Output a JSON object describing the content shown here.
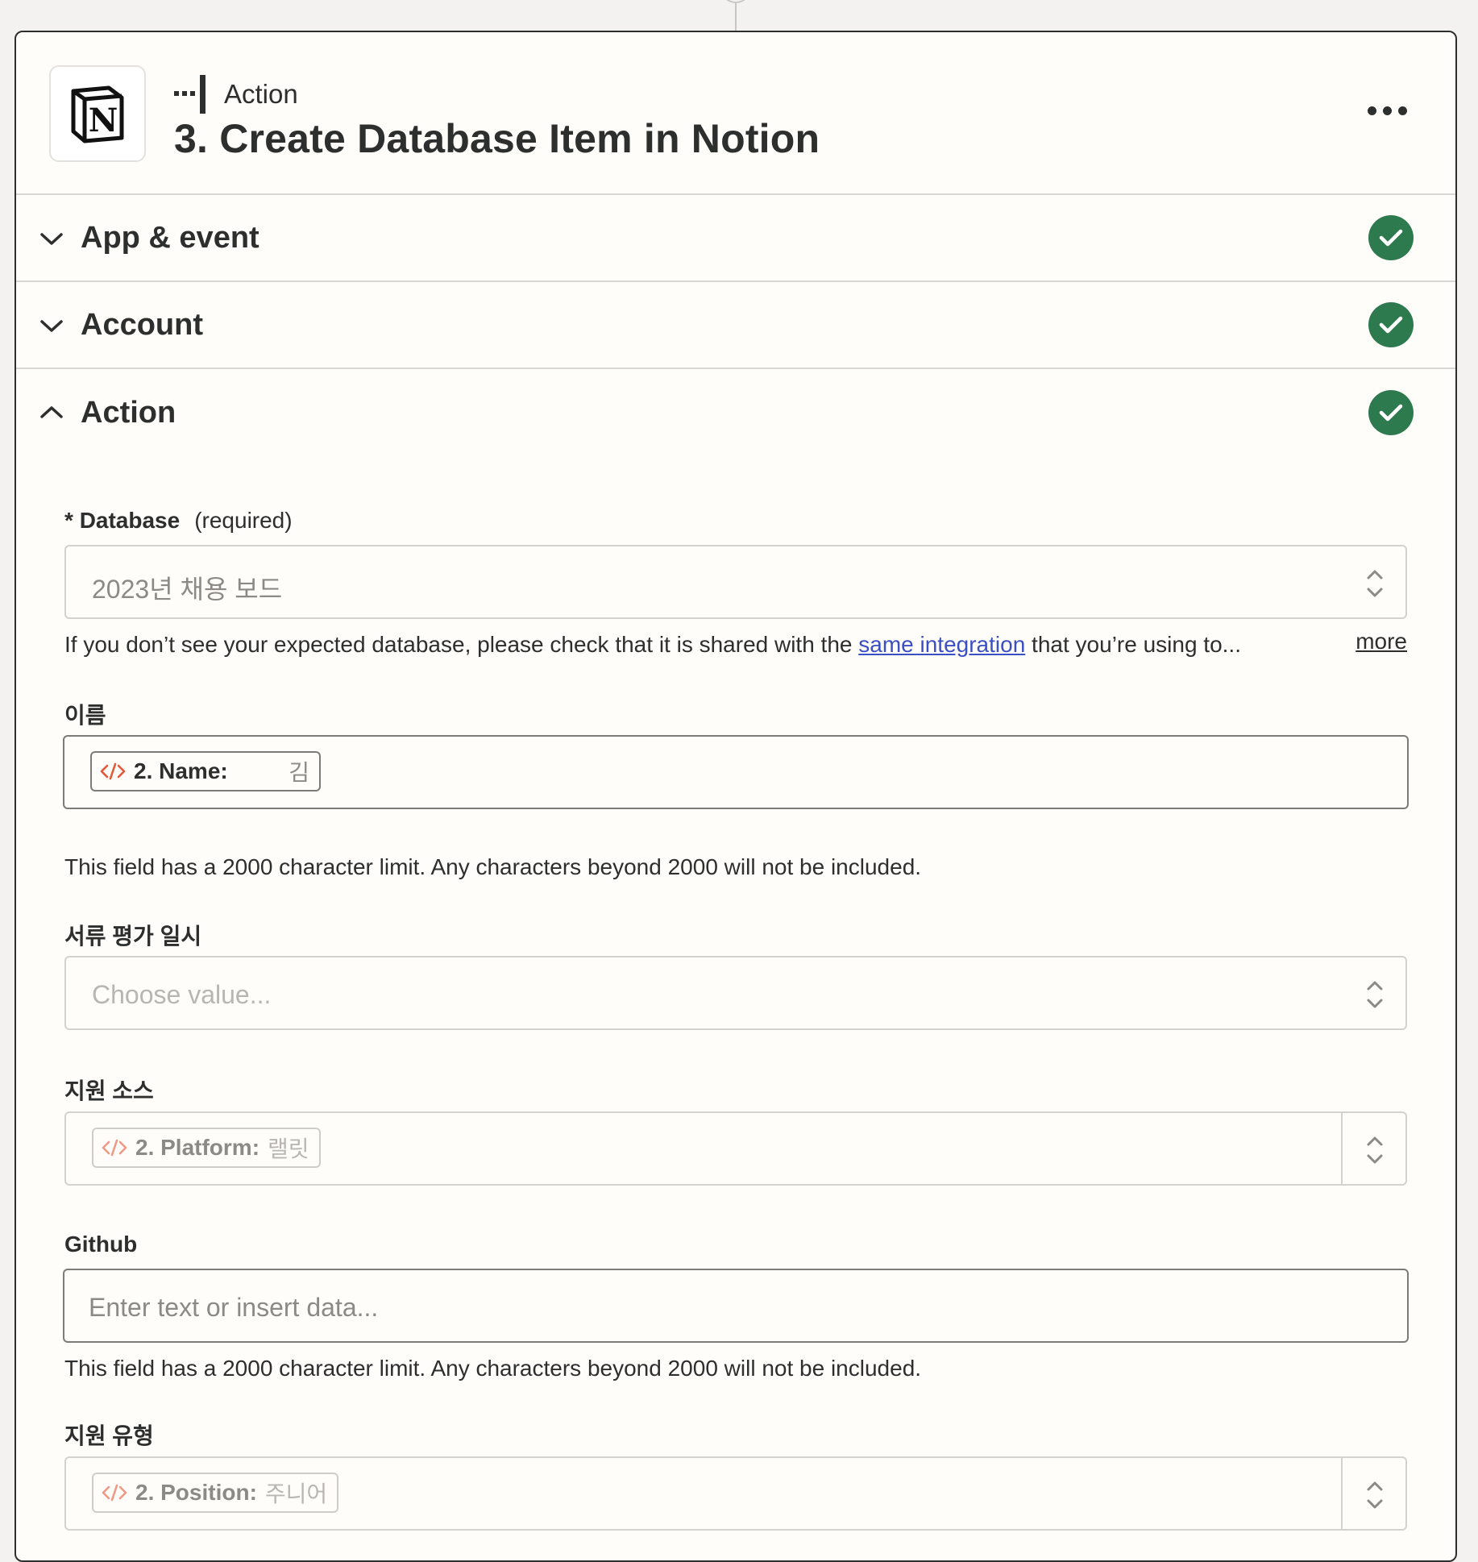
{
  "header": {
    "kind": "Action",
    "title": "3. Create Database Item in Notion"
  },
  "sections": [
    {
      "label": "App & event",
      "status": "complete"
    },
    {
      "label": "Account",
      "status": "complete"
    },
    {
      "label": "Action",
      "status": "complete"
    }
  ],
  "fields": {
    "database": {
      "label": "Database",
      "required_note": "(required)",
      "value": "2023년 채용 보드",
      "help_before": "If you don’t see your expected database, please check that it is shared with the ",
      "help_link": "same integration",
      "help_after": " that you’re using to...",
      "more": "more"
    },
    "name": {
      "label": "이름",
      "pill_key": "2. Name:",
      "pill_value": "김",
      "help": "This field has a 2000 character limit. Any characters beyond 2000 will not be included."
    },
    "review_date": {
      "label": "서류 평가 일시",
      "placeholder": "Choose value..."
    },
    "source": {
      "label": "지원 소스",
      "pill_key": "2. Platform:",
      "pill_value": "랠릿"
    },
    "github": {
      "label": "Github",
      "placeholder": "Enter text or insert data...",
      "help": "This field has a 2000 character limit. Any characters beyond 2000 will not be included."
    },
    "apply_type": {
      "label": "지원 유형",
      "pill_key": "2. Position:",
      "pill_value": "주니어"
    }
  },
  "colors": {
    "accent_check": "#2e7a4f",
    "link": "#3b4fc4",
    "code_icon": "#e2593b"
  }
}
